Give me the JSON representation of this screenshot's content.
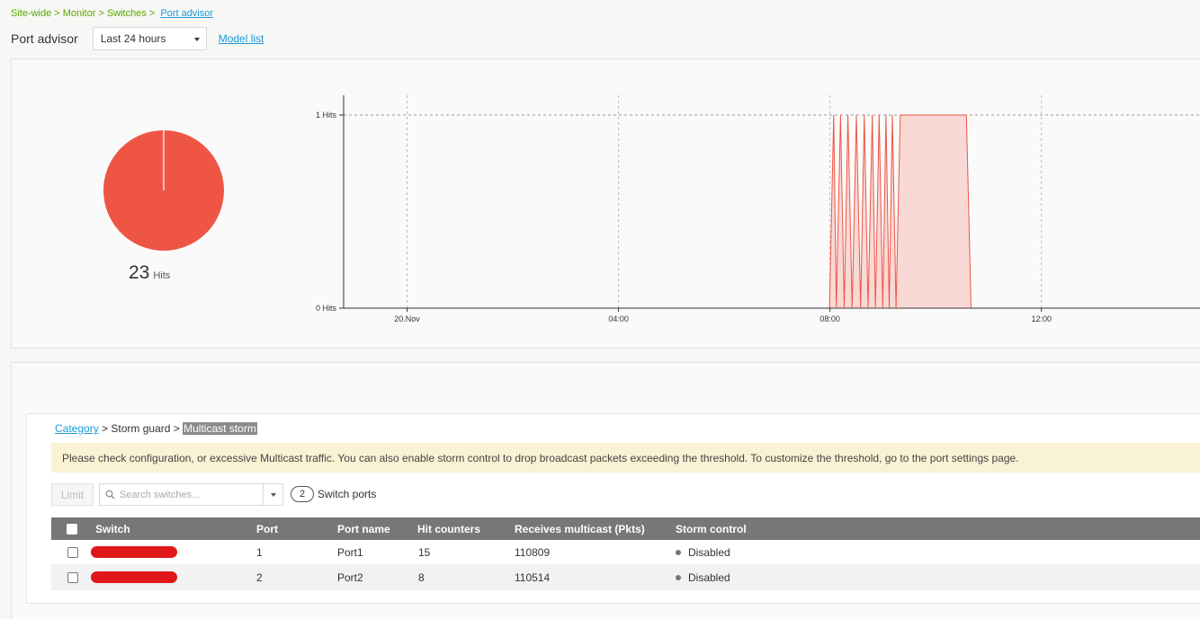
{
  "breadcrumb": {
    "items": [
      "Site-wide",
      "Monitor",
      "Switches"
    ],
    "current": "Port advisor"
  },
  "header": {
    "title": "Port advisor",
    "range_select": "Last 24 hours",
    "model_link": "Model list"
  },
  "summary": {
    "total_hits": "23",
    "total_label": "Hits",
    "pie_color": "#ef5545"
  },
  "chart_data": {
    "type": "area",
    "ylabels": [
      "1 Hits",
      "0 Hits"
    ],
    "ylim": [
      0,
      1
    ],
    "xlabels": [
      "20.Nov",
      "04:00",
      "08:00",
      "12:00"
    ],
    "x_hours": [
      0,
      4,
      8,
      12
    ],
    "xlim": [
      -1.2,
      15
    ],
    "grid": true,
    "series": [
      {
        "color": "#ef5545",
        "points": [
          [
            7.99,
            0
          ],
          [
            8.07,
            1
          ],
          [
            8.12,
            0
          ],
          [
            8.2,
            1
          ],
          [
            8.27,
            0
          ],
          [
            8.34,
            1
          ],
          [
            8.42,
            0
          ],
          [
            8.5,
            1
          ],
          [
            8.58,
            0
          ],
          [
            8.65,
            1
          ],
          [
            8.72,
            0
          ],
          [
            8.8,
            1
          ],
          [
            8.86,
            0
          ],
          [
            8.93,
            1
          ],
          [
            9.0,
            0
          ],
          [
            9.06,
            1
          ],
          [
            9.12,
            0
          ],
          [
            9.18,
            1
          ],
          [
            9.25,
            0
          ],
          [
            9.33,
            1
          ],
          [
            10.58,
            1
          ],
          [
            10.67,
            0
          ]
        ]
      }
    ]
  },
  "detail": {
    "category_link": "Category",
    "category_mid": "Storm guard",
    "category_current": "Multicast storm",
    "notice": "Please check configuration, or excessive Multicast traffic. You can also enable storm control to drop broadcast packets exceeding the threshold. To customize the threshold, go to the port settings page.",
    "limit_label": "Limit",
    "search_placeholder": "Search switches...",
    "port_count": "2",
    "port_count_label": "Switch ports"
  },
  "table": {
    "headers": {
      "switch": "Switch",
      "port": "Port",
      "port_name": "Port name",
      "hit_counters": "Hit counters",
      "receives": "Receives multicast (Pkts)",
      "storm": "Storm control"
    },
    "rows": [
      {
        "port": "1",
        "port_name": "Port1",
        "hits": "15",
        "receives": "110809",
        "storm": "Disabled"
      },
      {
        "port": "2",
        "port_name": "Port2",
        "hits": "8",
        "receives": "110514",
        "storm": "Disabled"
      }
    ]
  }
}
